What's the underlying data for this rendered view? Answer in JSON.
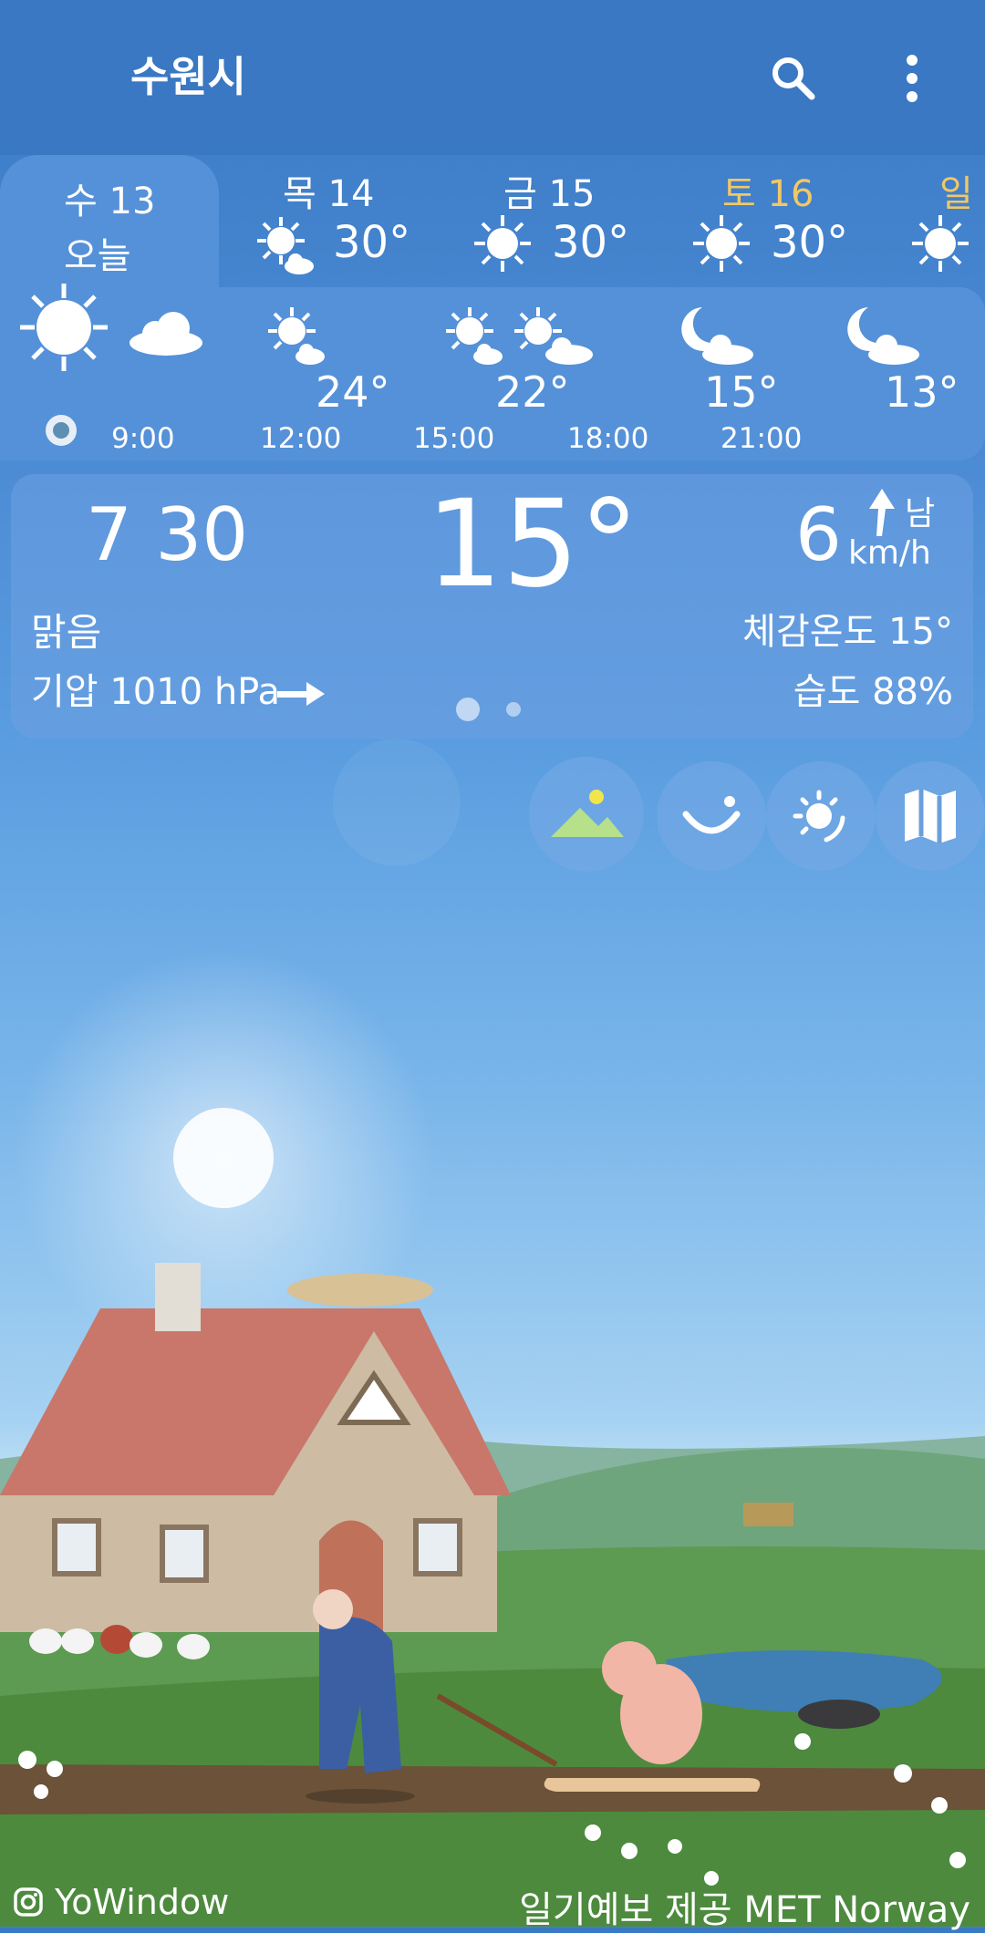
{
  "header": {
    "city": "수원시",
    "search_icon": "search-icon",
    "menu_icon": "more-vert-icon"
  },
  "days": [
    {
      "name": "수 13",
      "label": "오늘",
      "icon": "sun-icon",
      "today": true
    },
    {
      "name": "목 14",
      "temp": "30°",
      "icon": "sun-cloud-icon"
    },
    {
      "name": "금 15",
      "temp": "30°",
      "icon": "sun-icon"
    },
    {
      "name": "토 16",
      "temp": "30°",
      "icon": "sun-icon",
      "color": "#f0c866"
    },
    {
      "name": "일",
      "temp": "",
      "icon": "sun-icon",
      "color": "#f0c866"
    }
  ],
  "hourly": {
    "icons": [
      "sun-icon",
      "cloud-icon",
      "sun-cloud-icon",
      "sun-cloud-icon",
      "moon-cloud-icon",
      "moon-cloud-icon"
    ],
    "temps": [
      "24°",
      "22°",
      "15°",
      "13°"
    ],
    "times": [
      "9:00",
      "12:00",
      "15:00",
      "18:00",
      "21:00"
    ]
  },
  "current": {
    "time": "7 30",
    "temp": "15°",
    "wind_speed": "6",
    "wind_unit": "km/h",
    "wind_dir": "남",
    "condition": "맑음",
    "feels_like": "체감온도 15°",
    "pressure": "기압 1010 hPa",
    "humidity": "습도 88%",
    "page_count": 2,
    "page_active": 1
  },
  "actions": [
    "landscape-icon",
    "smile-icon",
    "sun-radar-icon",
    "map-icon"
  ],
  "footer": {
    "brand": "YoWindow",
    "credit": "일기예보 제공 MET Norway"
  },
  "colors": {
    "header": "#3a78c3",
    "panel": "#5591d8",
    "weekend": "#f0c866"
  }
}
